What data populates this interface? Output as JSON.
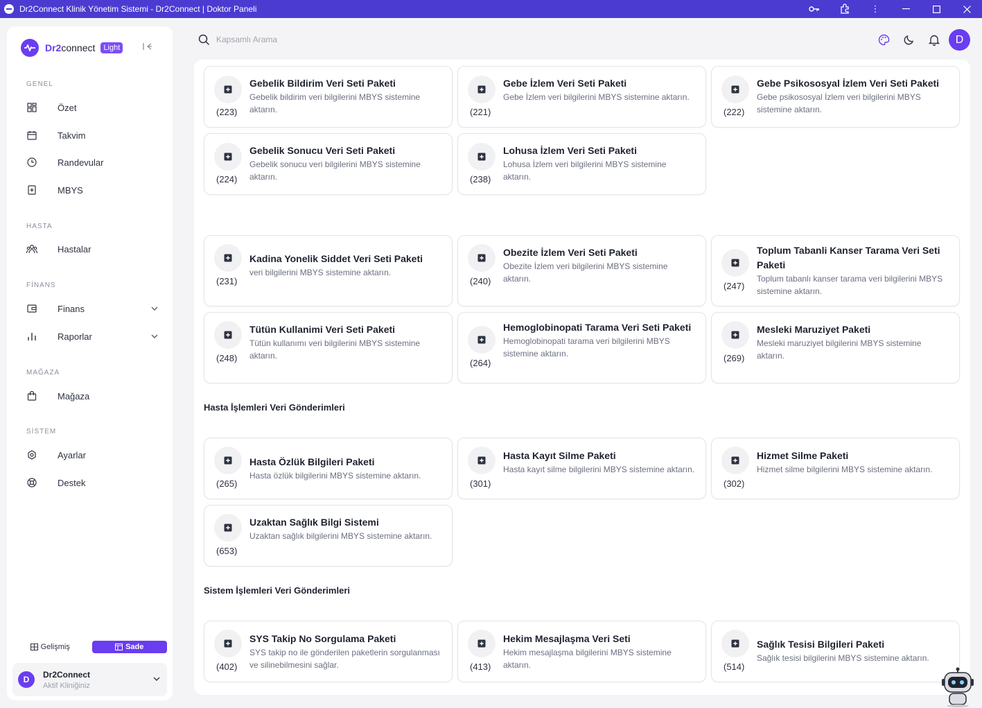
{
  "window": {
    "title": "Dr2Connect Klinik Yönetim Sistemi - Dr2Connect | Doktor Paneli",
    "controls": [
      "key-icon",
      "extension-icon",
      "more-vertical-icon",
      "minimize-icon",
      "maximize-icon",
      "close-icon"
    ]
  },
  "brand": {
    "prefix": "Dr2",
    "suffix": "connect",
    "badge": "Light"
  },
  "sidebar": {
    "sections": [
      {
        "label": "GENEL",
        "items": [
          {
            "label": "Özet",
            "icon": "dashboard-icon"
          },
          {
            "label": "Takvim",
            "icon": "calendar-icon"
          },
          {
            "label": "Randevular",
            "icon": "clock-icon"
          },
          {
            "label": "MBYS",
            "icon": "medical-file-icon"
          }
        ]
      },
      {
        "label": "HASTA",
        "items": [
          {
            "label": "Hastalar",
            "icon": "users-icon"
          }
        ]
      },
      {
        "label": "FİNANS",
        "items": [
          {
            "label": "Finans",
            "icon": "wallet-icon",
            "expandable": true
          },
          {
            "label": "Raporlar",
            "icon": "bar-chart-icon",
            "expandable": true
          }
        ]
      },
      {
        "label": "MAĞAZA",
        "items": [
          {
            "label": "Mağaza",
            "icon": "shopping-bag-icon"
          }
        ]
      },
      {
        "label": "SİSTEM",
        "items": [
          {
            "label": "Ayarlar",
            "icon": "settings-icon"
          },
          {
            "label": "Destek",
            "icon": "lifebuoy-icon"
          }
        ]
      }
    ],
    "mode": {
      "advanced": "Gelişmiş",
      "simple": "Sade",
      "selected": "Sade"
    },
    "clinic": {
      "avatar": "D",
      "name": "Dr2Connect",
      "subtitle": "Aktif Kliniğiniz"
    }
  },
  "topbar": {
    "search_placeholder": "Kapsamlı Arama",
    "icons": [
      "palette-icon",
      "moon-icon",
      "bell-icon"
    ],
    "user_avatar": "D"
  },
  "sections": {
    "patient": "Hasta İşlemleri Veri Gönderimleri",
    "system": "Sistem İşlemleri Veri Gönderimleri"
  },
  "cards": {
    "c223": {
      "code": "(223)",
      "title": "Gebelik Bildirim Veri Seti Paketi",
      "desc": "Gebelik bildirim veri bilgilerini MBYS sistemine aktarın."
    },
    "c221": {
      "code": "(221)",
      "title": "Gebe İzlem Veri Seti Paketi",
      "desc": "Gebe İzlem veri bilgilerini MBYS sistemine aktarın."
    },
    "c222": {
      "code": "(222)",
      "title": "Gebe Psikososyal İzlem Veri Seti Paketi",
      "desc": "Gebe psikososyal İzlem veri bilgilerini MBYS sistemine aktarın."
    },
    "c224": {
      "code": "(224)",
      "title": "Gebelik Sonucu Veri Seti Paketi",
      "desc": "Gebelik sonucu veri bilgilerini MBYS sistemine aktarın."
    },
    "c238": {
      "code": "(238)",
      "title": "Lohusa İzlem Veri Seti Paketi",
      "desc": "Lohusa İzlem veri bilgilerini MBYS sistemine aktarın."
    },
    "c231": {
      "code": "(231)",
      "title": "Kadina Yonelik Siddet Veri Seti Paketi",
      "desc": "veri bilgilerini MBYS sistemine aktarın."
    },
    "c240": {
      "code": "(240)",
      "title": "Obezite İzlem Veri Seti Paketi",
      "desc": "Obezite İzlem veri bilgilerini MBYS sistemine aktarın."
    },
    "c247": {
      "code": "(247)",
      "title": "Toplum Tabanli Kanser Tarama Veri Seti Paketi",
      "desc": "Toplum tabanlı kanser tarama veri bilgilerini MBYS sistemine aktarın."
    },
    "c248": {
      "code": "(248)",
      "title": "Tütün Kullanimi Veri Seti Paketi",
      "desc": "Tütün kullanımı veri bilgilerini MBYS sistemine aktarın."
    },
    "c264": {
      "code": "(264)",
      "title": "Hemoglobinopati Tarama Veri Seti Paketi",
      "desc": "Hemoglobinopati tarama veri bilgilerini MBYS sistemine aktarın."
    },
    "c269": {
      "code": "(269)",
      "title": "Mesleki Maruziyet Paketi",
      "desc": "Mesleki maruziyet bilgilerini MBYS sistemine aktarın."
    },
    "c265": {
      "code": "(265)",
      "title": "Hasta Özlük Bilgileri Paketi",
      "desc": "Hasta özlük bilgilerini MBYS sistemine aktarın."
    },
    "c301": {
      "code": "(301)",
      "title": "Hasta Kayıt Silme Paketi",
      "desc": "Hasta kayıt silme bilgilerini MBYS sistemine aktarın."
    },
    "c302": {
      "code": "(302)",
      "title": "Hizmet Silme Paketi",
      "desc": "Hizmet silme bilgilerini MBYS sistemine aktarın."
    },
    "c653": {
      "code": "(653)",
      "title": "Uzaktan Sağlık Bilgi Sistemi",
      "desc": "Uzaktan sağlık bilgilerini MBYS sistemine aktarın."
    },
    "c402": {
      "code": "(402)",
      "title": "SYS Takip No Sorgulama Paketi",
      "desc": "SYS takip no ile gönderilen paketlerin sorgulanması ve silinebilmesini sağlar."
    },
    "c413": {
      "code": "(413)",
      "title": "Hekim Mesajlaşma Veri Seti",
      "desc": "Hekim mesajlaşma bilgilerini MBYS sistemine aktarın."
    },
    "c514": {
      "code": "(514)",
      "title": "Sağlık Tesisi Bilgileri Paketi",
      "desc": "Sağlık tesisi bilgilerini MBYS sistemine aktarın."
    }
  },
  "assistant": {
    "icon": "robot-assistant-icon"
  }
}
